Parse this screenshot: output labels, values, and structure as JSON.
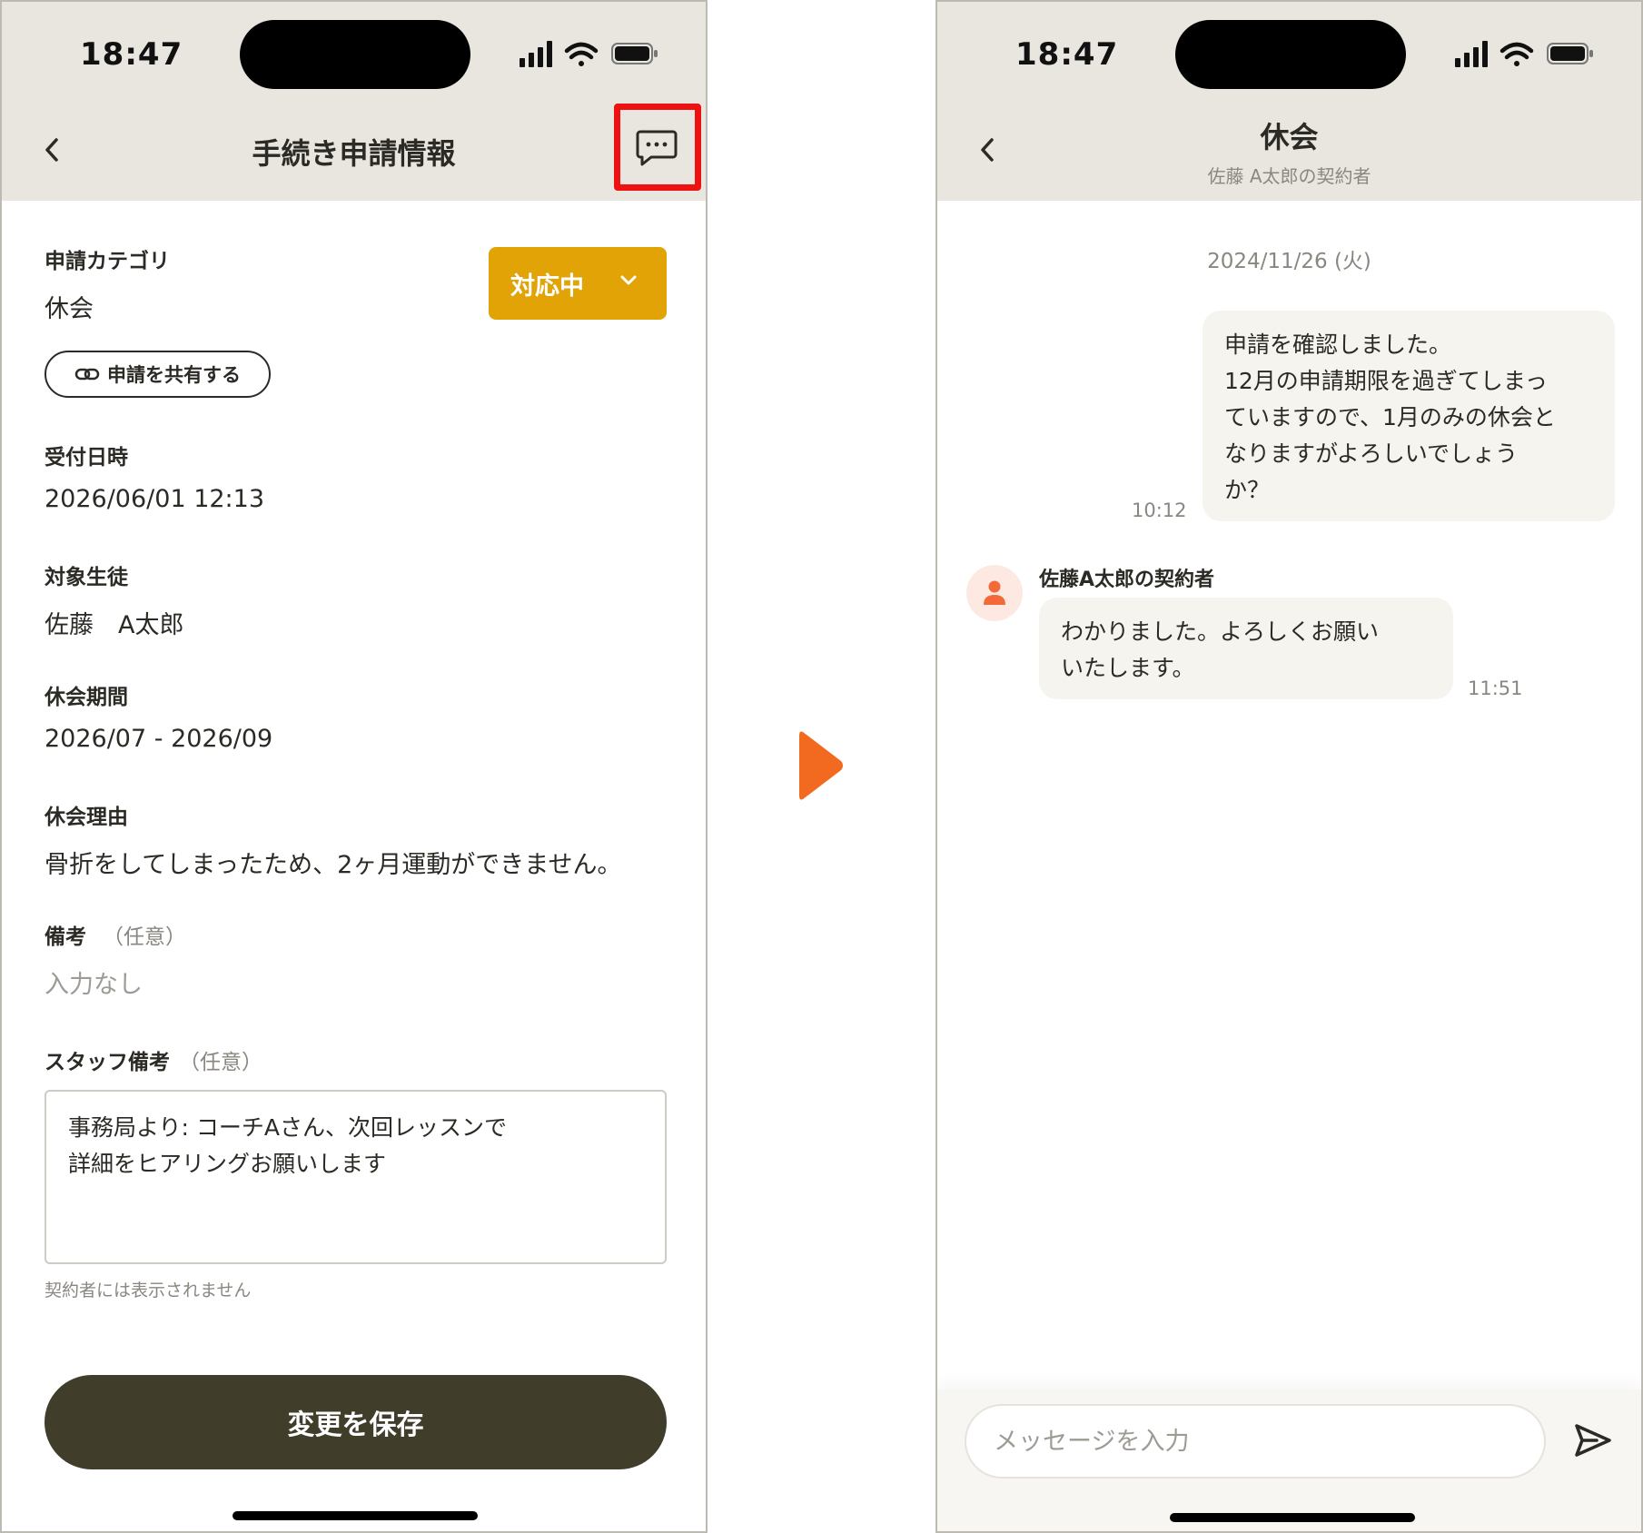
{
  "status_bar": {
    "time": "18:47"
  },
  "left": {
    "title": "手続き申請情報",
    "fields": {
      "category_label": "申請カテゴリ",
      "category_value": "休会",
      "received_label": "受付日時",
      "received_value": "2026/06/01 12:13",
      "student_label": "対象生徒",
      "student_value": "佐藤　A太郎",
      "period_label": "休会期間",
      "period_value": "2026/07 - 2026/09",
      "reason_label": "休会理由",
      "reason_value": "骨折をしてしまったため、2ヶ月運動ができません。",
      "remarks_label": "備考",
      "remarks_optional": "（任意）",
      "remarks_value": "入力なし",
      "staff_remarks_label": "スタッフ備考",
      "staff_remarks_optional": "（任意）",
      "staff_remarks_value": "事務局より: コーチAさん、次回レッスンで\n詳細をヒアリングお願いします",
      "staff_remarks_help": "契約者には表示されません"
    },
    "status_select": {
      "value": "対応中"
    },
    "share_button": "申請を共有する",
    "save_button": "変更を保存"
  },
  "right": {
    "title": "休会",
    "subtitle": "佐藤 A太郎の契約者",
    "date_separator": "2024/11/26 (火)",
    "messages": [
      {
        "text": "申請を確認しました。\n12月の申請期限を過ぎてしまっ\nていますので、1月のみの休会と\nなりますがよろしいでしょう\nか？",
        "time": "10:12"
      },
      {
        "sender": "佐藤A太郎の契約者",
        "text": "わかりました。よろしくお願い\nいたします。",
        "time": "11:51"
      }
    ],
    "input": {
      "placeholder": "メッセージを入力"
    }
  },
  "colors": {
    "header_bg": "#e8e6df",
    "accent_status": "#e1a306",
    "save_button": "#403d2b",
    "arrow": "#f26a1f",
    "highlight_box": "#ee1111"
  },
  "icons": [
    "back-chevron-icon",
    "chat-bubble-icon",
    "chevron-down-icon",
    "link-icon",
    "person-icon",
    "send-icon",
    "signal-icon",
    "wifi-icon",
    "battery-icon"
  ]
}
